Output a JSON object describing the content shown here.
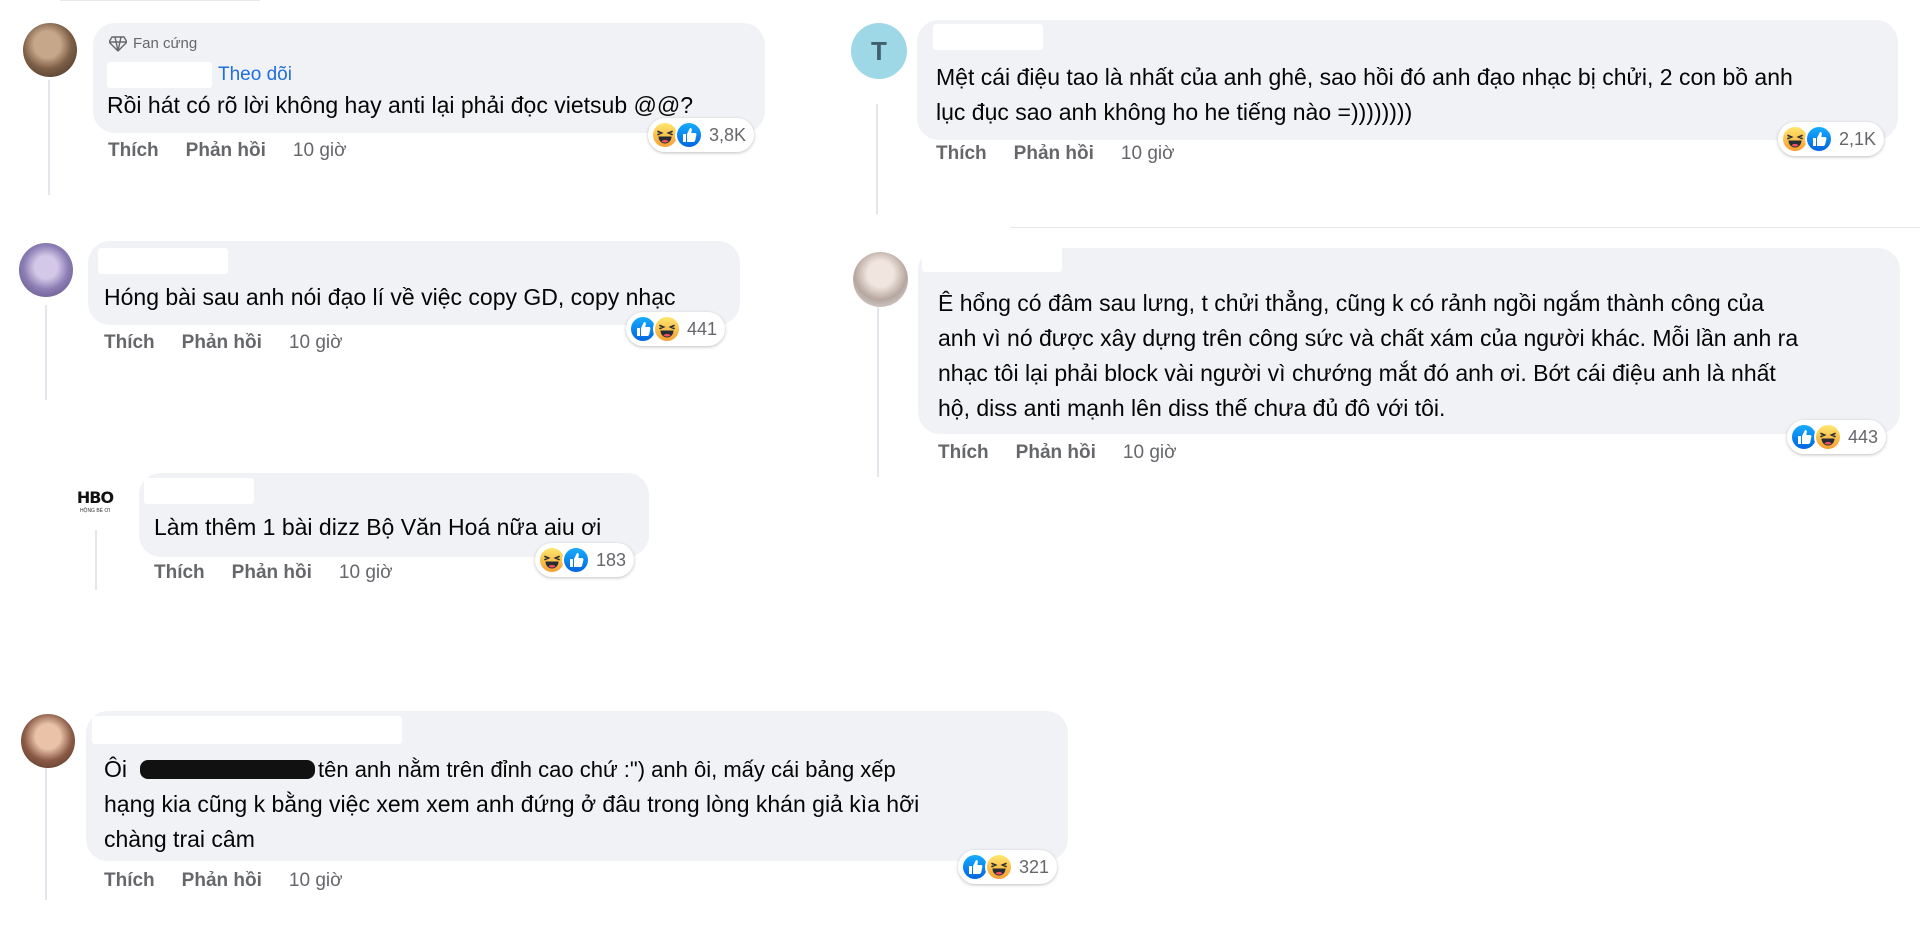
{
  "ui": {
    "like_label": "Thích",
    "reply_label": "Phản hồi"
  },
  "comments": [
    {
      "id": "c1",
      "badge": "Fan cứng",
      "follow": "Theo dõi",
      "lines": "Rồi hát có rõ lời không hay anti lại phải đọc vietsub @@?",
      "time": "10 giờ",
      "reaction_count": "3,8K",
      "reactions": [
        "haha-icon",
        "like-icon"
      ]
    },
    {
      "id": "c2",
      "avatar_letter": "T",
      "lines": "Mệt cái điệu tao là nhất của anh ghê, sao hồi đó anh đạo nhạc bị chửi, 2 con bồ anh\nlục đục sao anh không ho he tiếng nào =))))))))",
      "time": "10 giờ",
      "reaction_count": "2,1K",
      "reactions": [
        "haha-icon",
        "like-icon"
      ]
    },
    {
      "id": "c3",
      "lines": "Hóng bài sau anh nói đạo lí về việc copy GD, copy nhạc",
      "time": "10 giờ",
      "reaction_count": "441",
      "reactions": [
        "like-icon",
        "haha-icon"
      ]
    },
    {
      "id": "c4",
      "lines": "Ê hổng có đâm sau lưng, t chửi thẳng, cũng k có rảnh ngồi ngắm thành công của\nanh vì nó được xây dựng trên công sức và chất xám của người khác. Mỗi lần anh ra\nnhạc tôi lại phải block vài người vì chướng mắt đó anh ơi. Bớt cái điệu anh là nhất\nhộ, diss anti mạnh lên diss thế chưa đủ đô với tôi.",
      "time": "10 giờ",
      "reaction_count": "443",
      "reactions": [
        "like-icon",
        "haha-icon"
      ]
    },
    {
      "id": "c5",
      "avatar_text": "HBO",
      "avatar_subtext": "HỘNG BÉ ƠI",
      "lines": "Làm thêm 1 bài dizz Bộ Văn Hoá nữa aiu ơi",
      "time": "10 giờ",
      "reaction_count": "183",
      "reactions": [
        "haha-icon",
        "like-icon"
      ]
    },
    {
      "id": "c6",
      "prefix": "Ôi",
      "lines": "tên anh nằm trên đỉnh cao chứ :\") anh ôi, mấy cái bảng xếp",
      "lines_2": "hạng kia cũng k bằng việc xem xem anh đứng ở đâu trong lòng khán giả kìa hỡi\nchàng trai câm",
      "time": "10 giờ",
      "reaction_count": "321",
      "reactions": [
        "like-icon",
        "haha-icon"
      ]
    }
  ],
  "colors": {
    "bubble": "#f0f2f5",
    "muted_text": "#65676b",
    "link_blue": "#216fdb",
    "like_blue": "#1877f2",
    "haha_yellow": "#f7c842"
  }
}
